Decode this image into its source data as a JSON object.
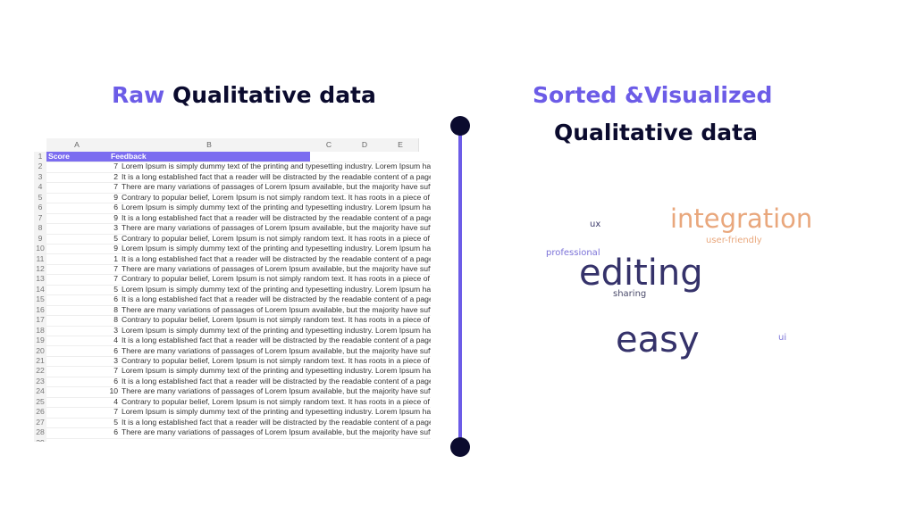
{
  "left_title": {
    "accent": "Raw",
    "rest": "Qualitative data"
  },
  "right_title": {
    "line1": "Sorted &Visualized",
    "line2": "Qualitative data"
  },
  "sheet": {
    "columns": [
      "A",
      "B",
      "C",
      "D",
      "E"
    ],
    "headers": {
      "score": "Score",
      "feedback": "Feedback"
    },
    "sentences": [
      "Lorem Ipsum is simply dummy text of the printing and typesetting industry. Lorem Ipsum has been the",
      "It is a long established fact that a reader will be distracted by the readable content of a page when loo",
      "There are many variations of passages of Lorem Ipsum available, but the majority have suffered altera",
      "Contrary to popular belief, Lorem Ipsum is not simply random text. It has roots in a piece of classical L"
    ],
    "scores": [
      7,
      2,
      7,
      9,
      6,
      9,
      3,
      5,
      9,
      1,
      7,
      7,
      5,
      6,
      8,
      8,
      3,
      4,
      6,
      3,
      7,
      6,
      10,
      4,
      7,
      5,
      6
    ],
    "last_row_number": "29"
  },
  "word_cloud": [
    {
      "word": "integration",
      "color": "#e9a77c"
    },
    {
      "word": "ux",
      "color": "#3b3a6b"
    },
    {
      "word": "user-friendly",
      "color": "#e9a77c"
    },
    {
      "word": "professional",
      "color": "#7b72d8"
    },
    {
      "word": "editing",
      "color": "#35326a"
    },
    {
      "word": "sharing",
      "color": "#4a4a6a"
    },
    {
      "word": "easy",
      "color": "#35326a"
    },
    {
      "word": "ui",
      "color": "#7b72d8"
    }
  ]
}
